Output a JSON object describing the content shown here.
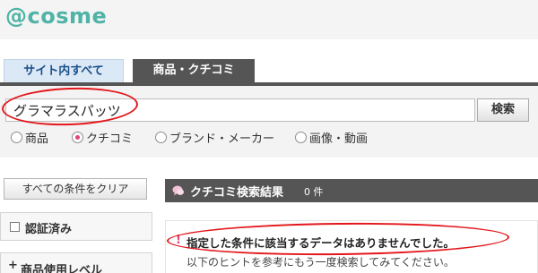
{
  "header": {
    "logo_text": "@cosme"
  },
  "tabs": [
    {
      "label": "サイト内すべて"
    },
    {
      "label": "商品・クチコミ"
    }
  ],
  "search": {
    "query": "グラマラスパッツ",
    "button_label": "検索"
  },
  "radio_options": [
    {
      "label": "商品",
      "checked": false
    },
    {
      "label": "クチコミ",
      "checked": true
    },
    {
      "label": "ブランド・メーカー",
      "checked": false
    },
    {
      "label": "画像・動画",
      "checked": false
    }
  ],
  "sidebar": {
    "clear_button_label": "すべての条件をクリア",
    "filters": [
      {
        "label": "認証済み"
      },
      {
        "label": "商品使用レベル"
      }
    ]
  },
  "results": {
    "title": "クチコミ検索結果",
    "count": "0 件",
    "no_results_message": "指定した条件に該当するデータはありませんでした。",
    "hint": "以下のヒントを参考にもう一度検索してみてください。"
  },
  "colors": {
    "brand": "#4fb3a6",
    "tab_active": "#555555",
    "tab_inactive_bg": "#dbe8f5",
    "annotation": "#e3171c",
    "accent_pink": "#e0457b"
  }
}
